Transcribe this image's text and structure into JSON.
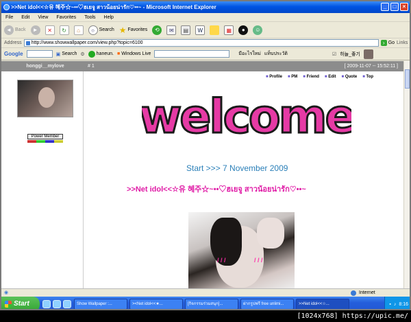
{
  "window": {
    "title": ">>Net idol<<☆유 혜주☆~••♡ฮเยจู สาวน้อยน่ารัก♡••~ - Microsoft Internet Explorer",
    "minimize": "_",
    "maximize": "□",
    "close": "×"
  },
  "menu": [
    "File",
    "Edit",
    "View",
    "Favorites",
    "Tools",
    "Help"
  ],
  "toolbar": {
    "back": "Back",
    "search": "Search",
    "favorites": "Favorites"
  },
  "address": {
    "label": "Address",
    "url": "http://www.showwallpaper.com/view.php?topic=6100",
    "go": "Go",
    "links": "Links"
  },
  "gbar": {
    "google": "Google",
    "search": "Search",
    "user": "haneun.",
    "windows_live": "Windows Live",
    "thai1": "มีอะไรใหม่",
    "thai2": "แท็บประวัติ",
    "korean": "하늘_좋기"
  },
  "post": {
    "username": "honggi__mylove",
    "number": "# 1",
    "date": "[ 2009-11-07 -- 15:52:11 ]",
    "rank": "Power Member",
    "buttons": [
      "Profile",
      "PM",
      "Friend",
      "Edit",
      "Quote",
      "Top"
    ],
    "welcome": "welcome",
    "start": "Start >>> 7 November 2009",
    "netidol": ">>Net idol<<☆유 혜주☆~••♡ฮเยจู สาวน้อยน่ารัก♡••~"
  },
  "status": {
    "zone": "Internet"
  },
  "taskbar": {
    "start": "Start",
    "tasks": [
      "Show Wallpaper :...",
      "><Net idol<<★...",
      "[กิจกรรมร่วมสนุก]...",
      "ฝากรูปฟรี free unlimi...",
      ">>Net idol<<☆..."
    ],
    "time": "8:16"
  },
  "footer": "[1024x768] https://upic.me/"
}
